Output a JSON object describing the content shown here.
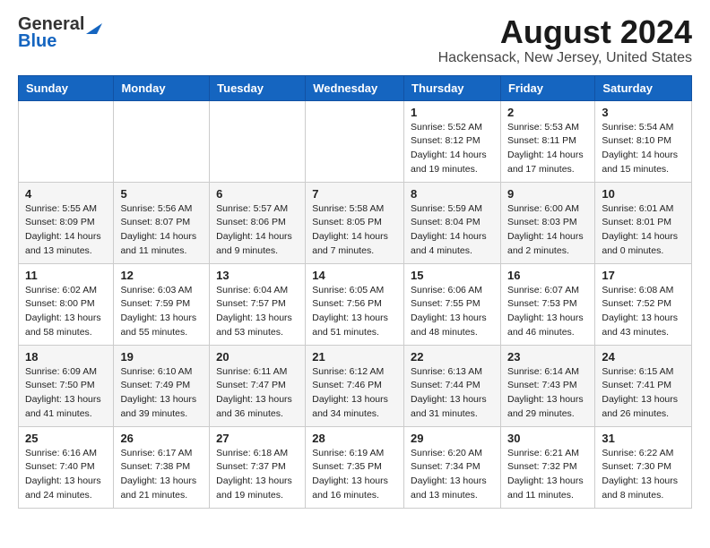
{
  "logo": {
    "general": "General",
    "blue": "Blue"
  },
  "title": "August 2024",
  "location": "Hackensack, New Jersey, United States",
  "weekdays": [
    "Sunday",
    "Monday",
    "Tuesday",
    "Wednesday",
    "Thursday",
    "Friday",
    "Saturday"
  ],
  "weeks": [
    [
      {
        "day": "",
        "info": ""
      },
      {
        "day": "",
        "info": ""
      },
      {
        "day": "",
        "info": ""
      },
      {
        "day": "",
        "info": ""
      },
      {
        "day": "1",
        "info": "Sunrise: 5:52 AM\nSunset: 8:12 PM\nDaylight: 14 hours\nand 19 minutes."
      },
      {
        "day": "2",
        "info": "Sunrise: 5:53 AM\nSunset: 8:11 PM\nDaylight: 14 hours\nand 17 minutes."
      },
      {
        "day": "3",
        "info": "Sunrise: 5:54 AM\nSunset: 8:10 PM\nDaylight: 14 hours\nand 15 minutes."
      }
    ],
    [
      {
        "day": "4",
        "info": "Sunrise: 5:55 AM\nSunset: 8:09 PM\nDaylight: 14 hours\nand 13 minutes."
      },
      {
        "day": "5",
        "info": "Sunrise: 5:56 AM\nSunset: 8:07 PM\nDaylight: 14 hours\nand 11 minutes."
      },
      {
        "day": "6",
        "info": "Sunrise: 5:57 AM\nSunset: 8:06 PM\nDaylight: 14 hours\nand 9 minutes."
      },
      {
        "day": "7",
        "info": "Sunrise: 5:58 AM\nSunset: 8:05 PM\nDaylight: 14 hours\nand 7 minutes."
      },
      {
        "day": "8",
        "info": "Sunrise: 5:59 AM\nSunset: 8:04 PM\nDaylight: 14 hours\nand 4 minutes."
      },
      {
        "day": "9",
        "info": "Sunrise: 6:00 AM\nSunset: 8:03 PM\nDaylight: 14 hours\nand 2 minutes."
      },
      {
        "day": "10",
        "info": "Sunrise: 6:01 AM\nSunset: 8:01 PM\nDaylight: 14 hours\nand 0 minutes."
      }
    ],
    [
      {
        "day": "11",
        "info": "Sunrise: 6:02 AM\nSunset: 8:00 PM\nDaylight: 13 hours\nand 58 minutes."
      },
      {
        "day": "12",
        "info": "Sunrise: 6:03 AM\nSunset: 7:59 PM\nDaylight: 13 hours\nand 55 minutes."
      },
      {
        "day": "13",
        "info": "Sunrise: 6:04 AM\nSunset: 7:57 PM\nDaylight: 13 hours\nand 53 minutes."
      },
      {
        "day": "14",
        "info": "Sunrise: 6:05 AM\nSunset: 7:56 PM\nDaylight: 13 hours\nand 51 minutes."
      },
      {
        "day": "15",
        "info": "Sunrise: 6:06 AM\nSunset: 7:55 PM\nDaylight: 13 hours\nand 48 minutes."
      },
      {
        "day": "16",
        "info": "Sunrise: 6:07 AM\nSunset: 7:53 PM\nDaylight: 13 hours\nand 46 minutes."
      },
      {
        "day": "17",
        "info": "Sunrise: 6:08 AM\nSunset: 7:52 PM\nDaylight: 13 hours\nand 43 minutes."
      }
    ],
    [
      {
        "day": "18",
        "info": "Sunrise: 6:09 AM\nSunset: 7:50 PM\nDaylight: 13 hours\nand 41 minutes."
      },
      {
        "day": "19",
        "info": "Sunrise: 6:10 AM\nSunset: 7:49 PM\nDaylight: 13 hours\nand 39 minutes."
      },
      {
        "day": "20",
        "info": "Sunrise: 6:11 AM\nSunset: 7:47 PM\nDaylight: 13 hours\nand 36 minutes."
      },
      {
        "day": "21",
        "info": "Sunrise: 6:12 AM\nSunset: 7:46 PM\nDaylight: 13 hours\nand 34 minutes."
      },
      {
        "day": "22",
        "info": "Sunrise: 6:13 AM\nSunset: 7:44 PM\nDaylight: 13 hours\nand 31 minutes."
      },
      {
        "day": "23",
        "info": "Sunrise: 6:14 AM\nSunset: 7:43 PM\nDaylight: 13 hours\nand 29 minutes."
      },
      {
        "day": "24",
        "info": "Sunrise: 6:15 AM\nSunset: 7:41 PM\nDaylight: 13 hours\nand 26 minutes."
      }
    ],
    [
      {
        "day": "25",
        "info": "Sunrise: 6:16 AM\nSunset: 7:40 PM\nDaylight: 13 hours\nand 24 minutes."
      },
      {
        "day": "26",
        "info": "Sunrise: 6:17 AM\nSunset: 7:38 PM\nDaylight: 13 hours\nand 21 minutes."
      },
      {
        "day": "27",
        "info": "Sunrise: 6:18 AM\nSunset: 7:37 PM\nDaylight: 13 hours\nand 19 minutes."
      },
      {
        "day": "28",
        "info": "Sunrise: 6:19 AM\nSunset: 7:35 PM\nDaylight: 13 hours\nand 16 minutes."
      },
      {
        "day": "29",
        "info": "Sunrise: 6:20 AM\nSunset: 7:34 PM\nDaylight: 13 hours\nand 13 minutes."
      },
      {
        "day": "30",
        "info": "Sunrise: 6:21 AM\nSunset: 7:32 PM\nDaylight: 13 hours\nand 11 minutes."
      },
      {
        "day": "31",
        "info": "Sunrise: 6:22 AM\nSunset: 7:30 PM\nDaylight: 13 hours\nand 8 minutes."
      }
    ]
  ]
}
